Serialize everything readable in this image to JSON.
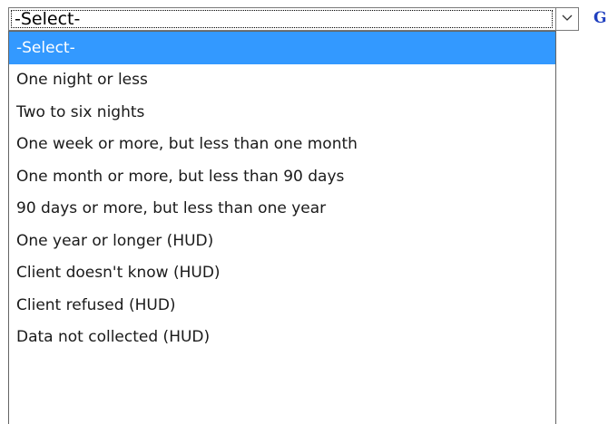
{
  "select": {
    "value": "-Select-"
  },
  "go_link": "G",
  "dropdown": {
    "options": [
      "-Select-",
      "One night or less",
      "Two to six nights",
      "One week or more, but less than one month",
      "One month or more, but less than 90 days",
      "90 days or more, but less than one year",
      "One year or longer (HUD)",
      "Client doesn't know (HUD)",
      "Client refused (HUD)",
      "Data not collected (HUD)",
      ""
    ],
    "selected_index": 0
  },
  "colors": {
    "highlight": "#3399ff",
    "link": "#1f3fbf",
    "border": "#7a7a7a"
  },
  "icons": {
    "dropdown_arrow": "chevron-down-icon"
  }
}
